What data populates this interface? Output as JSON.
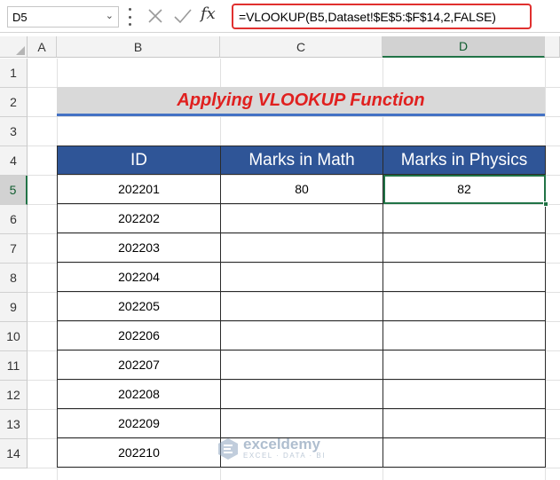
{
  "formula_bar": {
    "name_box": "D5",
    "formula": "=VLOOKUP(B5,Dataset!$E$5:$F$14,2,FALSE)",
    "cancel_icon": "x-icon",
    "enter_icon": "check-icon",
    "fx_label": "fx"
  },
  "columns": [
    "A",
    "B",
    "C",
    "D"
  ],
  "rows": [
    "1",
    "2",
    "3",
    "4",
    "5",
    "6",
    "7",
    "8",
    "9",
    "10",
    "11",
    "12",
    "13",
    "14"
  ],
  "selected_cell": "D5",
  "title": "Applying VLOOKUP Function",
  "table": {
    "headers": [
      "ID",
      "Marks in Math",
      "Marks in Physics"
    ],
    "rows": [
      [
        "202201",
        "80",
        "82"
      ],
      [
        "202202",
        "",
        ""
      ],
      [
        "202203",
        "",
        ""
      ],
      [
        "202204",
        "",
        ""
      ],
      [
        "202205",
        "",
        ""
      ],
      [
        "202206",
        "",
        ""
      ],
      [
        "202207",
        "",
        ""
      ],
      [
        "202208",
        "",
        ""
      ],
      [
        "202209",
        "",
        ""
      ],
      [
        "202210",
        "",
        ""
      ]
    ]
  },
  "watermark": {
    "name": "exceldemy",
    "tagline": "EXCEL · DATA · BI"
  },
  "colors": {
    "header_fill": "#2f5597",
    "title_text": "#e0201f",
    "title_fill": "#d9d9d9",
    "formula_highlight": "#e0302f",
    "selection": "#217346"
  }
}
